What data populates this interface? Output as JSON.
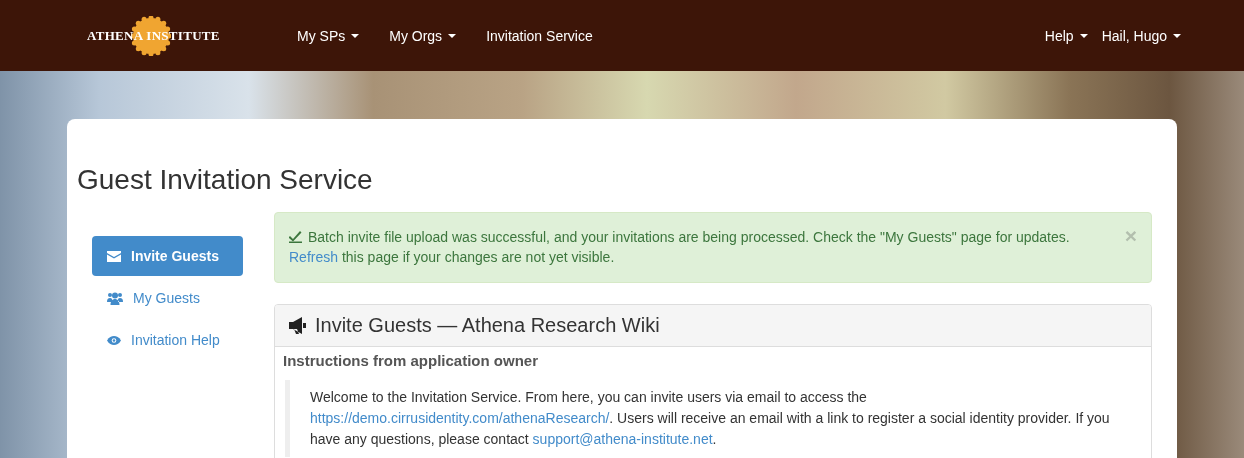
{
  "navbar": {
    "logo": "ATHENA INSTITUTE",
    "nav_items": [
      {
        "label": "My SPs",
        "dropdown": true
      },
      {
        "label": "My Orgs",
        "dropdown": true
      },
      {
        "label": "Invitation Service",
        "dropdown": false
      }
    ],
    "right_items": [
      {
        "label": "Help",
        "dropdown": true
      },
      {
        "label": "Hail, Hugo",
        "dropdown": true
      }
    ]
  },
  "page_title": "Guest Invitation Service",
  "sidebar": {
    "items": [
      {
        "label": "Invite Guests",
        "selected": true
      },
      {
        "label": "My Guests",
        "selected": false
      },
      {
        "label": "Invitation Help",
        "selected": false
      }
    ]
  },
  "alert": {
    "message": "Batch invite file upload was successful, and your invitations are being processed. Check the \"My Guests\" page for updates.",
    "link": "Refresh",
    "message_after": " this page if your changes are not yet visible.",
    "close": "×"
  },
  "panel": {
    "title": "Invite Guests — Athena Research Wiki",
    "subheading": "Instructions from application owner",
    "instructions": [
      {
        "kind": "text",
        "text": "Welcome to the Invitation Service. From here, you can invite users via email to access the "
      },
      {
        "kind": "link",
        "text": "https://demo.cirrusidentity.com/athenaResearch/"
      },
      {
        "kind": "text",
        "text": ". Users will receive an email with a link to register a social identity provider. If you have any questions, please contact "
      },
      {
        "kind": "link",
        "text": "support@athena-institute.net"
      },
      {
        "kind": "text",
        "text": "."
      }
    ]
  }
}
